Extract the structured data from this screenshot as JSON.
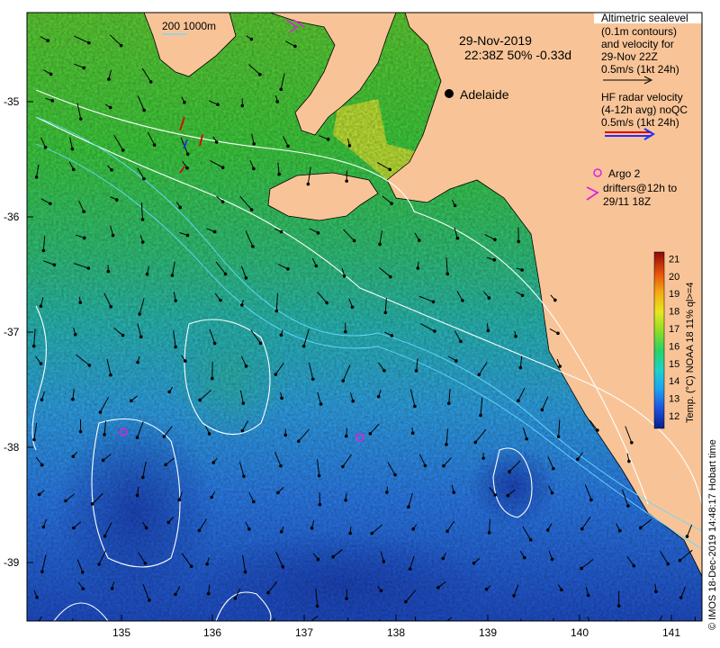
{
  "map": {
    "date_label": "29-Nov-2019",
    "pass_label": "22:38Z  50% -0.33d",
    "city_label": "Adelaide",
    "scale_label": "200  1000m",
    "altimetry_legend": [
      "Altimetric sealevel",
      "(0.1m contours)",
      "and velocity for",
      "29-Nov 22Z",
      "0.5m/s (1kt 24h)"
    ],
    "hf_radar_legend": [
      "HF radar velocity",
      "(4-12h avg) noQC",
      "0.5m/s (1kt 24h)"
    ],
    "argo_legend": [
      "Argo 2",
      "drifters@12h to",
      "29/11 18Z"
    ],
    "colorbar_title": "Temp. (°C) NOAA 18 11% ql>=4",
    "colorbar_ticks": [
      "12",
      "13",
      "14",
      "15",
      "16",
      "17",
      "18",
      "19",
      "20",
      "21"
    ],
    "credit": "© IMOS 18-Dec-2019 14:48:17 Hobart time",
    "lon_ticks": [
      "135",
      "136",
      "137",
      "138",
      "139",
      "140",
      "141"
    ],
    "lat_ticks": [
      "-35",
      "-36",
      "-37",
      "-38",
      "-39"
    ],
    "colors": {
      "land": "#f8c497",
      "sst_warm_gulf": "#f2e21a",
      "sst_shelf": "#3cc83c",
      "sst_mid": "#29b8a8",
      "sst_cool": "#2e7be6",
      "sst_cold": "#1f52c8",
      "contour": "#ffffff",
      "isobath": "#66d9ff",
      "hf_radar_primary": "#e00000",
      "hf_radar_secondary": "#2030ff",
      "argo": "#e020e0"
    }
  }
}
